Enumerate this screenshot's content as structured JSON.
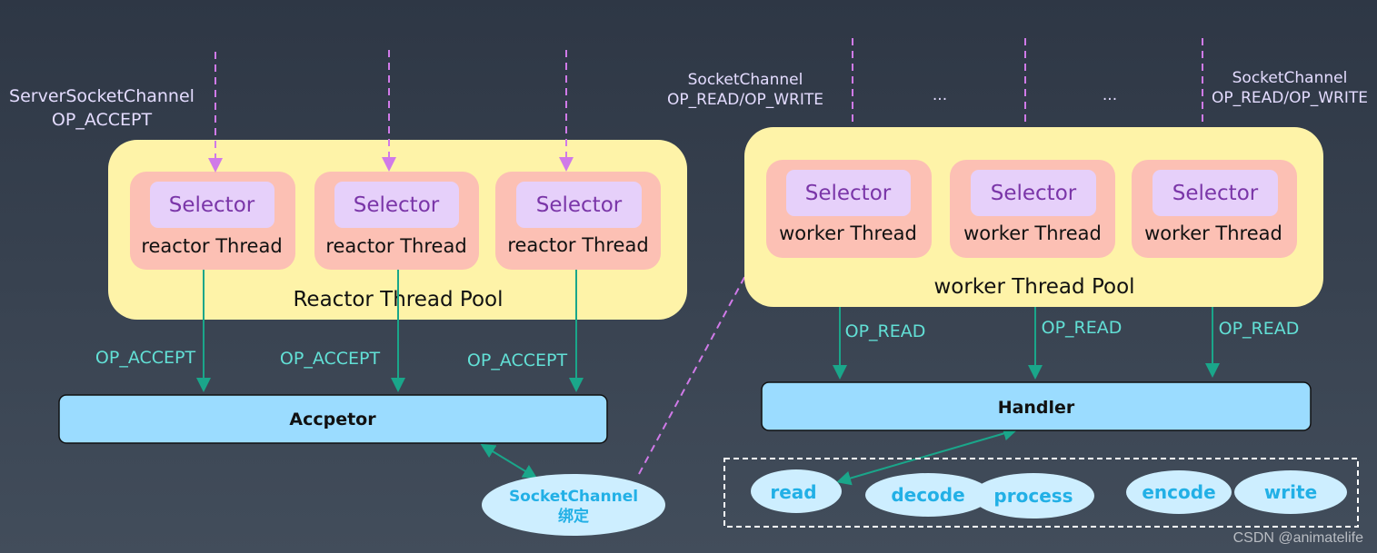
{
  "colors": {
    "pool": "#fef3a8",
    "thread": "#fcc0b4",
    "selector": "#e6d0fa",
    "box": "#9bdcff",
    "ellipse": "#cdeeff",
    "dashed_arrow": "#d07ae8",
    "solid_arrow": "#1aa68a"
  },
  "reactor": {
    "input_label": [
      "ServerSocketChannel",
      "OP_ACCEPT"
    ],
    "pool_label": "Reactor Thread Pool",
    "threads": [
      {
        "selector": "Selector",
        "label": "reactor Thread"
      },
      {
        "selector": "Selector",
        "label": "reactor Thread"
      },
      {
        "selector": "Selector",
        "label": "reactor Thread"
      }
    ],
    "edge_labels": [
      "OP_ACCEPT",
      "OP_ACCEPT",
      "OP_ACCEPT"
    ],
    "acceptor": "Accpetor",
    "socket_channel": [
      "SocketChannel",
      "绑定"
    ]
  },
  "worker": {
    "input_label_left": [
      "SocketChannel",
      "OP_READ/OP_WRITE"
    ],
    "input_label_right": [
      "SocketChannel",
      "OP_READ/OP_WRITE"
    ],
    "ellipsis": [
      "...",
      "..."
    ],
    "pool_label": "worker Thread Pool",
    "threads": [
      {
        "selector": "Selector",
        "label": "worker Thread"
      },
      {
        "selector": "Selector",
        "label": "worker Thread"
      },
      {
        "selector": "Selector",
        "label": "worker Thread"
      }
    ],
    "edge_labels": [
      "OP_READ",
      "OP_READ",
      "OP_READ"
    ],
    "handler": "Handler",
    "steps": [
      "read",
      "decode",
      "process",
      "encode",
      "write"
    ]
  },
  "watermark": "CSDN @animatelife"
}
